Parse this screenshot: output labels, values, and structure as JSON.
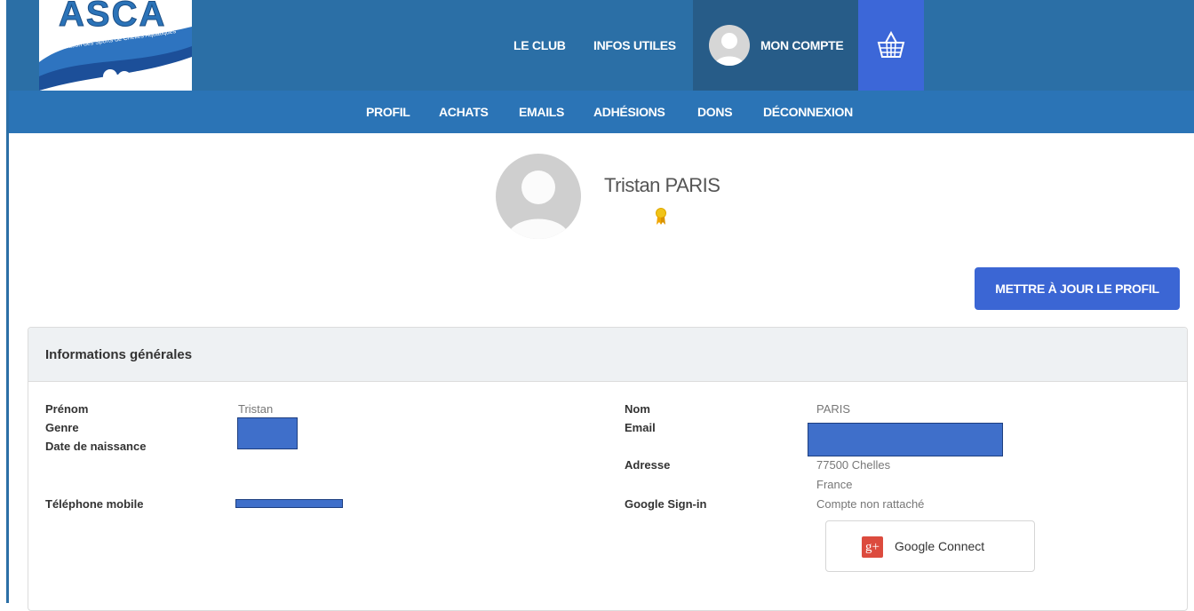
{
  "header": {
    "logo": {
      "text": "ASCA",
      "tagline": "Association des Sports de Chelles Aquatiques"
    },
    "nav": {
      "club": "LE CLUB",
      "infos": "INFOS UTILES",
      "account": "MON COMPTE",
      "cart_icon": "basket-icon"
    }
  },
  "subnav": {
    "items": [
      "PROFIL",
      "ACHATS",
      "EMAILS",
      "ADHÉSIONS",
      "DONS",
      "DÉCONNEXION"
    ]
  },
  "profile": {
    "name": "Tristan PARIS",
    "badge_icon": "award-icon",
    "update_button": "METTRE À JOUR LE PROFIL"
  },
  "panel": {
    "title": "Informations générales",
    "left": {
      "prenom_label": "Prénom",
      "prenom_value": "Tristan",
      "genre_label": "Genre",
      "dob_label": "Date de naissance",
      "phone_label": "Téléphone mobile"
    },
    "right": {
      "nom_label": "Nom",
      "nom_value": "PARIS",
      "email_label": "Email",
      "adresse_label": "Adresse",
      "adresse_line1": "77500 Chelles",
      "adresse_line2": "France",
      "google_label": "Google Sign-in",
      "google_value": "Compte non rattaché",
      "google_button": "Google Connect",
      "google_icon_text": "g+"
    }
  },
  "colors": {
    "header_bg": "#2b6fa6",
    "subnav_bg": "#2b74b6",
    "account_bg": "#275c88",
    "cart_bg": "#3c67d8",
    "primary_button": "#3b66d4",
    "google_red": "#dc4b3e",
    "redaction": "#3f6fca"
  }
}
